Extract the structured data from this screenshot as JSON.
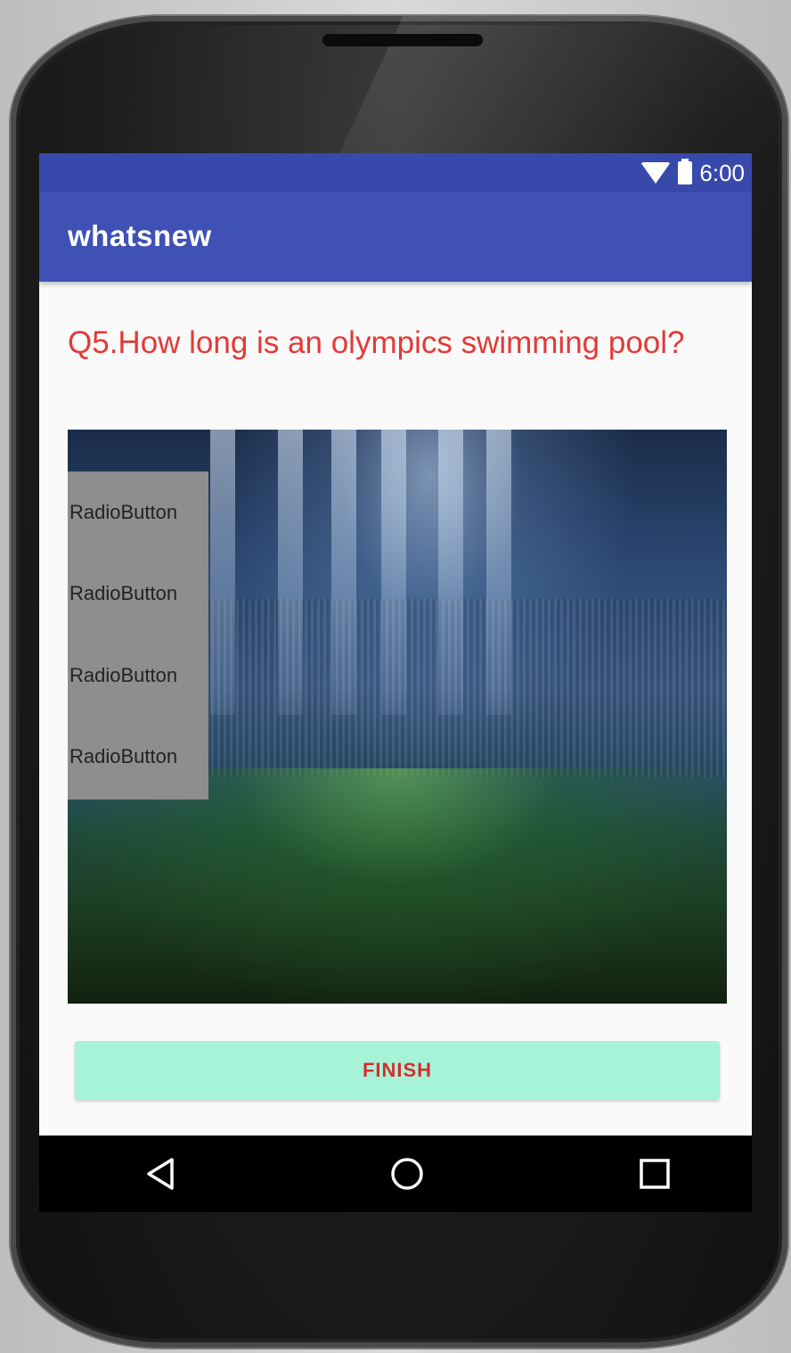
{
  "status_bar": {
    "time": "6:00",
    "icons": [
      "wifi-icon",
      "battery-icon"
    ]
  },
  "app_bar": {
    "title": "whatsnew"
  },
  "quiz": {
    "question": "Q5.How long is an olympics swimming pool?",
    "image": "stadium-image",
    "options": [
      "RadioButton",
      "RadioButton",
      "RadioButton",
      "RadioButton"
    ],
    "finish_label": "FINISH"
  },
  "navigation_bar": {
    "icons": [
      "back-icon",
      "home-icon",
      "recents-icon"
    ]
  },
  "colors": {
    "status_bar": "#3949ab",
    "app_bar": "#3f51b5",
    "question_text": "#e53935",
    "finish_button": "#a7f3d8",
    "finish_text": "#d32f2f",
    "radio_panel": "#8e8e8e"
  }
}
